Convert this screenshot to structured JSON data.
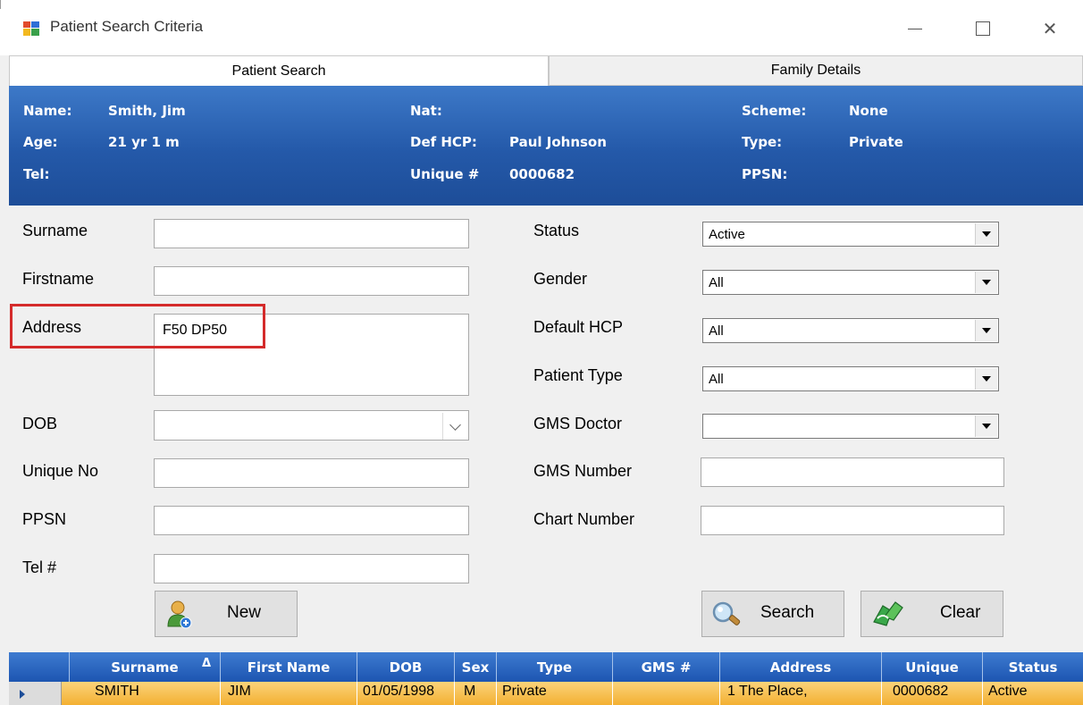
{
  "window": {
    "title": "Patient Search Criteria"
  },
  "tabs": [
    {
      "label": "Patient Search"
    },
    {
      "label": "Family Details"
    }
  ],
  "header": {
    "name_label": "Name:",
    "name_value": "Smith, Jim",
    "age_label": "Age:",
    "age_value": "21 yr 1 m",
    "tel_label": "Tel:",
    "nat_label": "Nat:",
    "defhcp_label": "Def HCP:",
    "defhcp_value": "Paul Johnson",
    "unique_label": "Unique #",
    "unique_value": "0000682",
    "scheme_label": "Scheme:",
    "scheme_value": "None",
    "type_label": "Type:",
    "type_value": "Private",
    "ppsn_label": "PPSN:"
  },
  "form": {
    "surname_label": "Surname",
    "firstname_label": "Firstname",
    "address_label": "Address",
    "address_value": "F50 DP50",
    "dob_label": "DOB",
    "unique_label": "Unique No",
    "ppsn_label": "PPSN",
    "tel_label": "Tel #",
    "status_label": "Status",
    "status_value": "Active",
    "gender_label": "Gender",
    "gender_value": "All",
    "defhcp_label": "Default HCP",
    "defhcp_value": "All",
    "ptype_label": "Patient Type",
    "ptype_value": "All",
    "gmsdoc_label": "GMS Doctor",
    "gmsdoc_value": "",
    "gmsnum_label": "GMS Number",
    "chart_label": "Chart Number"
  },
  "buttons": {
    "new": "New",
    "search": "Search",
    "clear": "Clear"
  },
  "grid": {
    "columns": [
      "Surname",
      "First Name",
      "DOB",
      "Sex",
      "Type",
      "GMS #",
      "Address",
      "Unique",
      "Status"
    ],
    "sort_indicator": "Δ",
    "rows": [
      {
        "surname": "SMITH",
        "firstname": "JIM",
        "dob": "01/05/1998",
        "sex": "M",
        "type": "Private",
        "gms": "",
        "address": "1 The Place,",
        "unique": "0000682",
        "status": "Active"
      }
    ]
  },
  "colors": {
    "header_band": "#2459a9",
    "grid_row": "#f3b032",
    "highlight": "#d42b2b"
  }
}
